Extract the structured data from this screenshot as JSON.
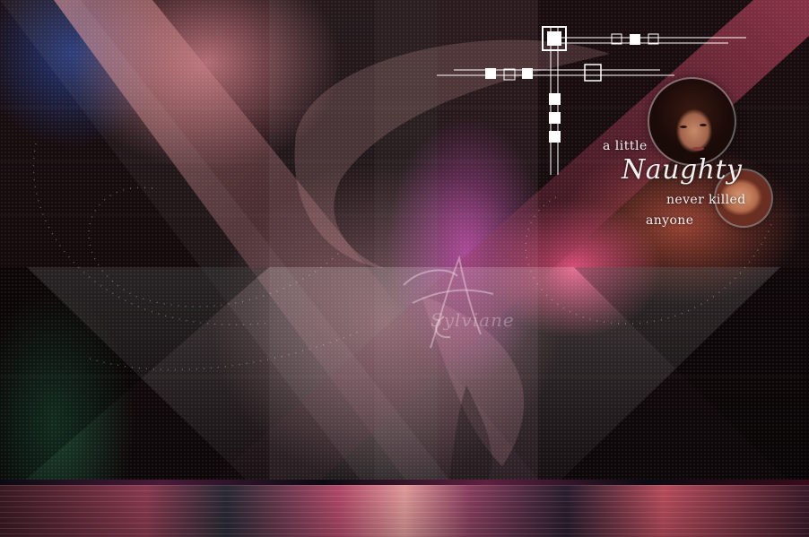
{
  "caption": {
    "line1": "a little",
    "line2": "Naughty",
    "line3": "never killed",
    "line4": "anyone"
  },
  "watermark": {
    "signature": "Sylviane"
  },
  "colors": {
    "accent_pink": "#e0408a",
    "accent_orange": "#f07a5a",
    "text_white": "#f4eef0"
  }
}
